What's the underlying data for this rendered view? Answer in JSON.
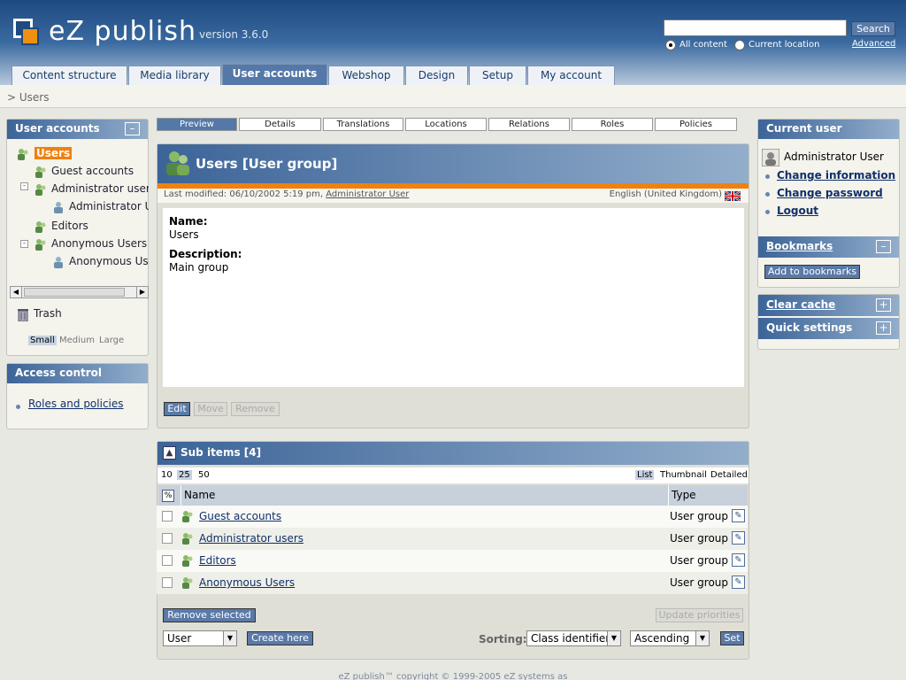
{
  "header": {
    "logo": "eZ publish",
    "version": "version 3.6.0",
    "search_button": "Search",
    "radio_all": "All content",
    "radio_current": "Current location",
    "advanced": "Advanced"
  },
  "tabs": [
    "Content structure",
    "Media library",
    "User accounts",
    "Webshop",
    "Design",
    "Setup",
    "My account"
  ],
  "breadcrumb": "> Users",
  "left": {
    "title": "User accounts",
    "tree": [
      {
        "label": "Users"
      },
      {
        "label": "Guest accounts"
      },
      {
        "label": "Administrator users"
      },
      {
        "label": "Administrator U"
      },
      {
        "label": "Editors"
      },
      {
        "label": "Anonymous Users"
      },
      {
        "label": "Anonymous Us"
      }
    ],
    "trash": "Trash",
    "sizes": [
      "Small",
      "Medium",
      "Large"
    ],
    "access_title": "Access control",
    "roles_link": "Roles and policies"
  },
  "subtabs": [
    "Preview",
    "Details",
    "Translations",
    "Locations",
    "Relations",
    "Roles",
    "Policies"
  ],
  "main": {
    "title": "Users [User group]",
    "modified": "Last modified: 06/10/2002 5:19 pm,",
    "modified_by": "Administrator User",
    "language": "English (United Kingdom)",
    "name_label": "Name:",
    "name_value": "Users",
    "desc_label": "Description:",
    "desc_value": "Main group",
    "edit": "Edit",
    "move": "Move",
    "remove": "Remove"
  },
  "subitems": {
    "title": "Sub items [4]",
    "limits": [
      "10",
      "25",
      "50"
    ],
    "views": [
      "List",
      "Thumbnail",
      "Detailed"
    ],
    "col_name": "Name",
    "col_type": "Type",
    "rows": [
      {
        "name": "Guest accounts",
        "type": "User group"
      },
      {
        "name": "Administrator users",
        "type": "User group"
      },
      {
        "name": "Editors",
        "type": "User group"
      },
      {
        "name": "Anonymous Users",
        "type": "User group"
      }
    ],
    "remove_selected": "Remove selected",
    "update_priorities": "Update priorities",
    "class_select": "User",
    "create_here": "Create here",
    "sorting_label": "Sorting:",
    "sort_field": "Class identifier",
    "sort_order": "Ascending",
    "set": "Set"
  },
  "right": {
    "current_user_title": "Current user",
    "user_name": "Administrator User",
    "links": [
      "Change information",
      "Change password",
      "Logout"
    ],
    "bookmarks_title": "Bookmarks",
    "add_bookmark": "Add to bookmarks",
    "clear_cache": "Clear cache",
    "quick_settings": "Quick settings"
  },
  "footer": "eZ publish™ copyright © 1999-2005 eZ systems as"
}
